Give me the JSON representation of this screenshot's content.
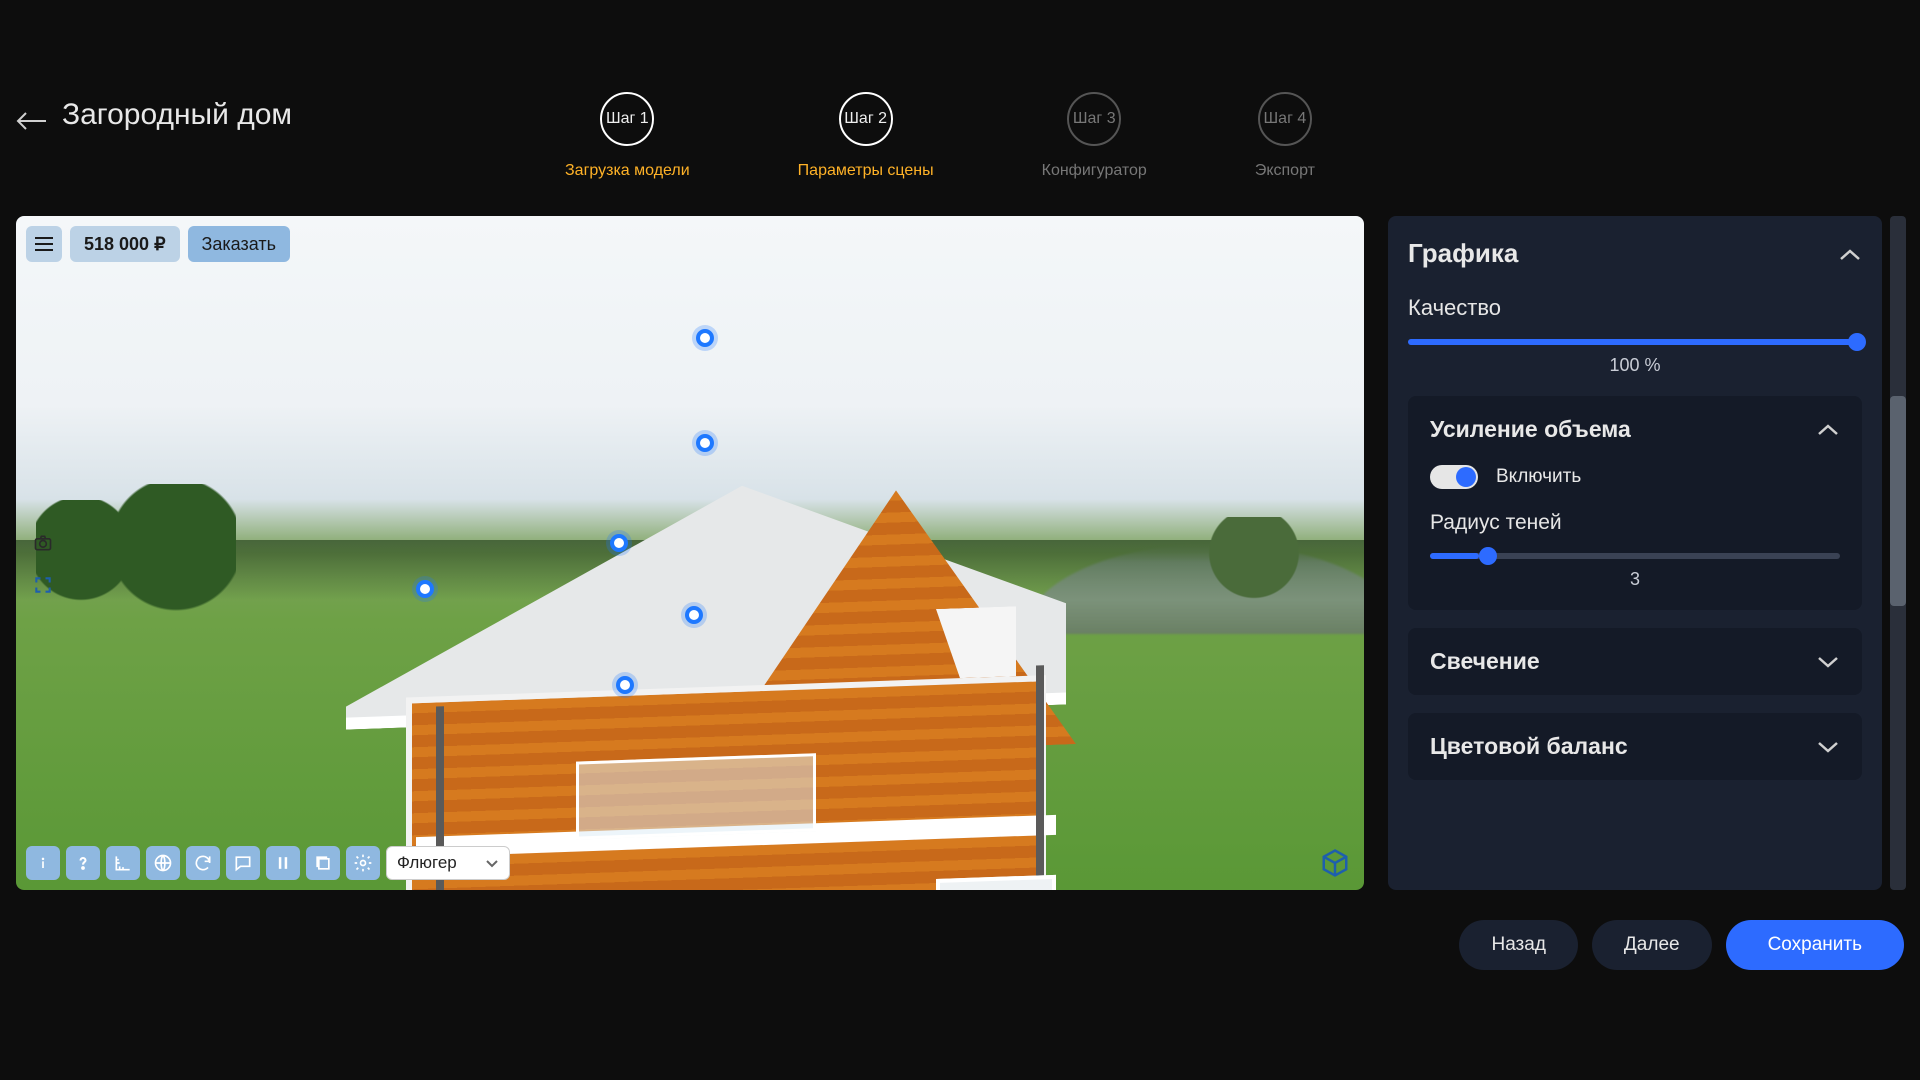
{
  "header": {
    "title": "Загородный дом"
  },
  "steps": [
    {
      "circle": "Шаг 1",
      "label": "Загрузка модели",
      "active": true
    },
    {
      "circle": "Шаг 2",
      "label": "Параметры сцены",
      "active": true
    },
    {
      "circle": "Шаг 3",
      "label": "Конфигуратор",
      "active": false
    },
    {
      "circle": "Шаг 4",
      "label": "Экспорт",
      "active": false
    }
  ],
  "viewport": {
    "price": "518 000 ₽",
    "order_label": "Заказать",
    "dropdown_selected": "Флюгер"
  },
  "sidebar": {
    "graphics_title": "Графика",
    "quality_label": "Качество",
    "quality_value": "100 %",
    "quality_percent": 100,
    "volume_boost": {
      "title": "Усиление объема",
      "enable_label": "Включить",
      "enabled": true,
      "shadow_radius_label": "Радиус теней",
      "shadow_radius_value": "3",
      "shadow_radius_percent": 12
    },
    "glow_title": "Свечение",
    "color_balance_title": "Цветовой баланс"
  },
  "footer": {
    "back": "Назад",
    "next": "Далее",
    "save": "Сохранить"
  }
}
